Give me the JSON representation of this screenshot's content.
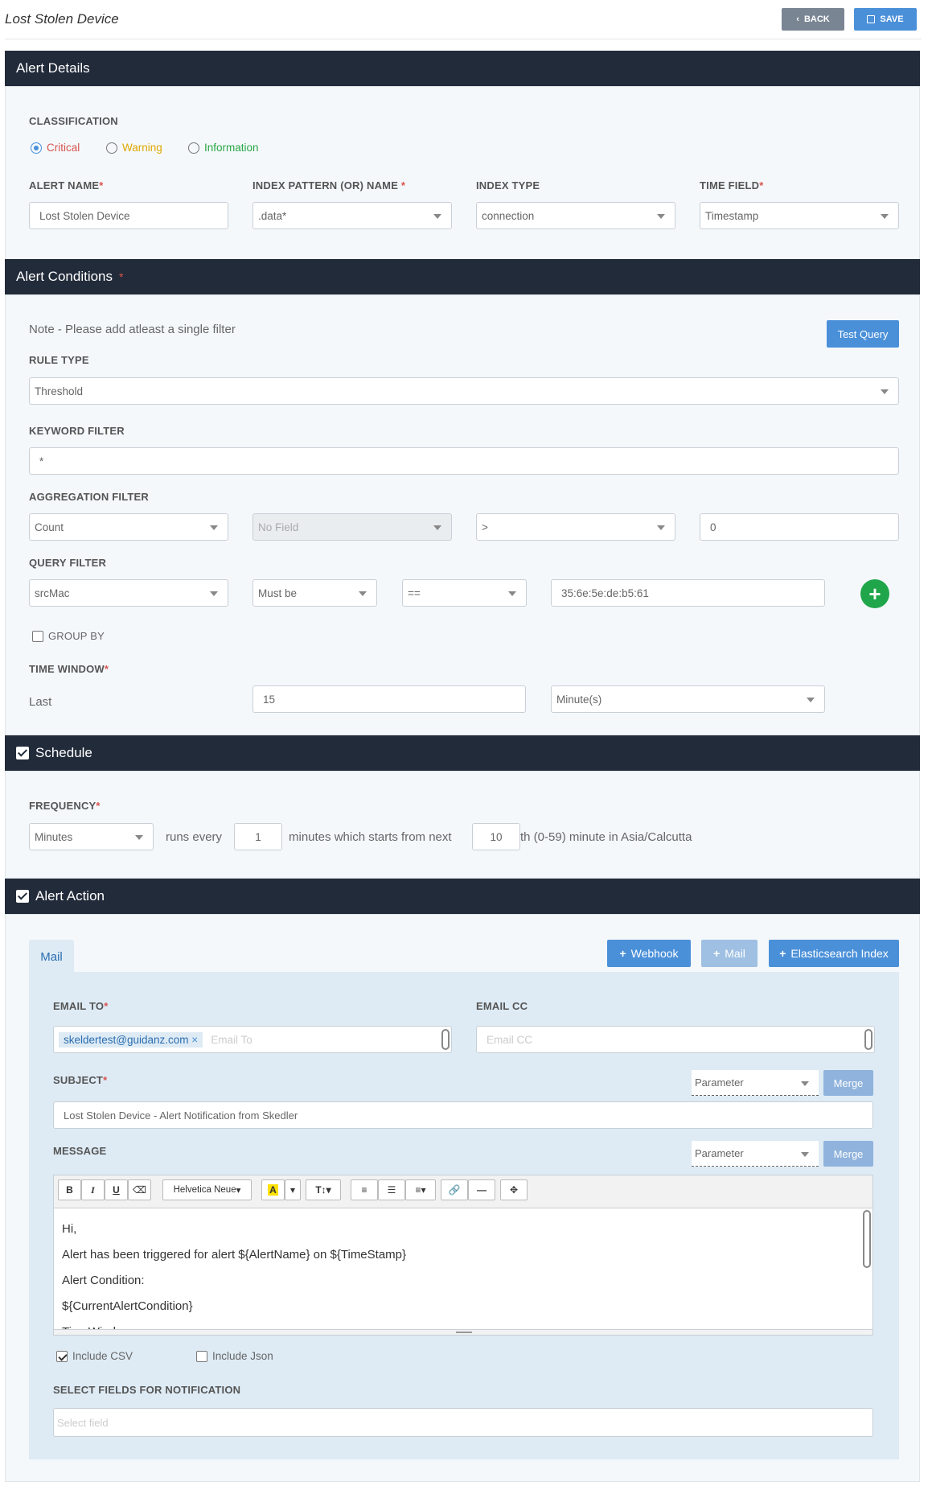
{
  "page": {
    "title": "Lost Stolen Device"
  },
  "toolbar": {
    "back_label": "BACK",
    "save_label": "SAVE"
  },
  "alert_details": {
    "heading": "Alert Details",
    "classification_label": "CLASSIFICATION",
    "classifications": [
      {
        "label": "Critical",
        "color": "#d9534f",
        "selected": true
      },
      {
        "label": "Warning",
        "color": "#e0a800",
        "selected": false
      },
      {
        "label": "Information",
        "color": "#28a745",
        "selected": false
      }
    ],
    "alert_name_label": "ALERT NAME",
    "alert_name_value": "Lost Stolen Device",
    "index_pattern_label": "INDEX PATTERN (OR) NAME",
    "index_pattern_value": ".data*",
    "index_type_label": "INDEX TYPE",
    "index_type_value": "connection",
    "time_field_label": "TIME FIELD",
    "time_field_value": "Timestamp",
    "required_mark": "*"
  },
  "alert_conditions": {
    "heading": "Alert Conditions",
    "note": "Note - Please add atleast a single filter",
    "test_query_label": "Test Query",
    "rule_type_label": "RULE TYPE",
    "rule_type_value": "Threshold",
    "keyword_filter_label": "KEYWORD FILTER",
    "keyword_filter_value": "*",
    "aggregation_filter_label": "AGGREGATION FILTER",
    "aggregation": {
      "function": "Count",
      "field": "No Field",
      "operator": ">",
      "value": "0"
    },
    "query_filter_label": "QUERY FILTER",
    "query": {
      "field": "srcMac",
      "condition": "Must be",
      "operator": "==",
      "value": "35:6e:5e:de:b5:61"
    },
    "group_by_label": "GROUP BY",
    "time_window_label": "TIME WINDOW",
    "last_label": "Last",
    "time_window_value": "15",
    "time_window_unit": "Minute(s)"
  },
  "schedule": {
    "heading": "Schedule",
    "frequency_label": "FREQUENCY",
    "frequency_value": "Minutes",
    "runs_every_text": "runs  every",
    "runs_every_value": "1",
    "minutes_text": "minutes  which starts from next",
    "start_minute_value": "10",
    "suffix_text": "th (0-59) minute in  Asia/Calcutta"
  },
  "alert_action": {
    "heading": "Alert Action",
    "tab_mail": "Mail",
    "webhook_label": "Webhook",
    "mail_label": "Mail",
    "elasticsearch_label": "Elasticsearch Index",
    "email_to_label": "EMAIL TO",
    "email_to_tag": "skeldertest@guidanz.com",
    "email_to_placeholder": "Email To",
    "email_cc_label": "EMAIL CC",
    "email_cc_placeholder": "Email CC",
    "subject_label": "SUBJECT",
    "parameter_label": "Parameter",
    "merge_label": "Merge",
    "subject_value": "Lost Stolen Device - Alert Notification from Skedler",
    "message_label": "MESSAGE",
    "font_name": "Helvetica Neue",
    "message_lines": [
      "Hi,",
      "Alert has been triggered for alert ${AlertName} on ${TimeStamp}",
      "Alert Condition:",
      "${CurrentAlertCondition}",
      "TimeWindow:"
    ],
    "include_csv_label": "Include CSV",
    "include_json_label": "Include Json",
    "select_fields_label": "SELECT FIELDS FOR NOTIFICATION",
    "select_fields_placeholder": "Select field"
  }
}
